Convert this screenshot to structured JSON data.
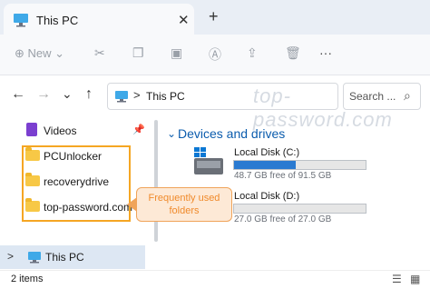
{
  "window": {
    "tab_title": "This PC",
    "tab_close": "✕",
    "new_tab": "+"
  },
  "toolbar": {
    "new_label": "New",
    "new_plus": "⊕",
    "more": "···"
  },
  "address": {
    "back": "←",
    "forward": "→",
    "dropdown": "⌄",
    "up": "↑",
    "separator": ">",
    "crumb": "This PC",
    "watermark": "top-password.com"
  },
  "search": {
    "placeholder": "Search ..."
  },
  "sidebar": {
    "items": [
      {
        "label": "Videos",
        "pinned": true
      },
      {
        "label": "PCUnlocker"
      },
      {
        "label": "recoverydrive"
      },
      {
        "label": "top-password.com"
      }
    ],
    "this_pc": "This PC"
  },
  "callout": {
    "line1": "Frequently used",
    "line2": "folders"
  },
  "main": {
    "section_title": "Devices and drives",
    "drives": [
      {
        "name": "Local Disk (C:)",
        "free_text": "48.7 GB free of 91.5 GB",
        "used_fraction": 0.47
      },
      {
        "name": "Local Disk (D:)",
        "free_text": "27.0 GB free of 27.0 GB",
        "used_fraction": 0.0
      }
    ]
  },
  "status": {
    "item_count": "2 items"
  },
  "colors": {
    "accent": "#0b5cad",
    "highlight": "#f5a623",
    "drive_fill": "#2a7ad1"
  }
}
